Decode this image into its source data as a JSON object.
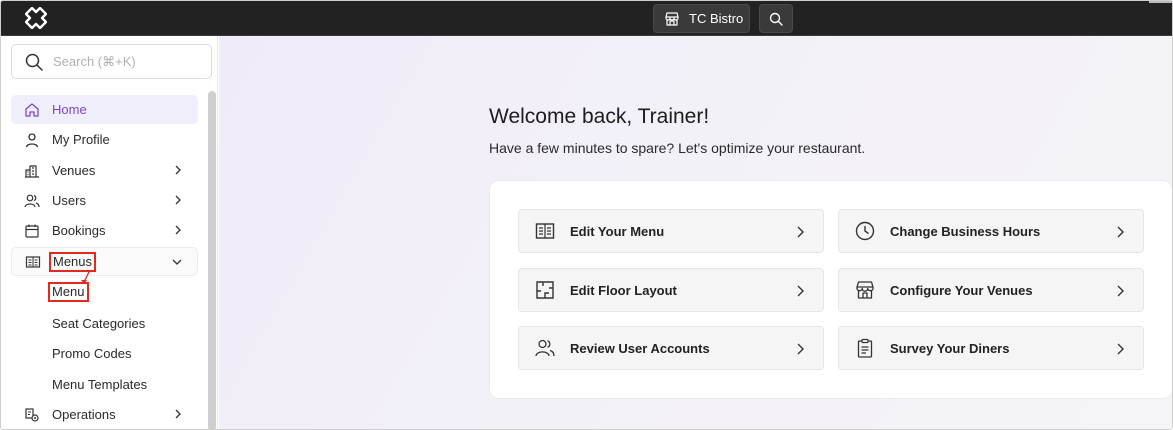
{
  "app": {
    "venue_name": "TC Bistro"
  },
  "sidebar": {
    "search_placeholder": "Search (⌘+K)",
    "items": [
      {
        "label": "Home",
        "icon": "home-icon"
      },
      {
        "label": "My Profile",
        "icon": "person-icon"
      },
      {
        "label": "Venues",
        "icon": "buildings-icon"
      },
      {
        "label": "Users",
        "icon": "users-icon"
      },
      {
        "label": "Bookings",
        "icon": "calendar-icon"
      },
      {
        "label": "Menus",
        "icon": "menu-book-icon"
      },
      {
        "label": "Operations",
        "icon": "operations-icon"
      }
    ],
    "sub_items": [
      {
        "label": "Menu"
      },
      {
        "label": "Seat Categories"
      },
      {
        "label": "Promo Codes"
      },
      {
        "label": "Menu Templates"
      }
    ]
  },
  "main": {
    "welcome": "Welcome back, Trainer!",
    "subtitle": "Have a few minutes to spare? Let's optimize your restaurant.",
    "tiles": [
      {
        "label": "Edit Your Menu",
        "icon": "menu-book-icon"
      },
      {
        "label": "Change Business Hours",
        "icon": "clock-icon"
      },
      {
        "label": "Edit Floor Layout",
        "icon": "floor-plan-icon"
      },
      {
        "label": "Configure Your Venues",
        "icon": "storefront-icon"
      },
      {
        "label": "Review User Accounts",
        "icon": "users-icon"
      },
      {
        "label": "Survey Your Diners",
        "icon": "clipboard-icon"
      }
    ]
  },
  "colors": {
    "accent": "#7a46c9",
    "highlight": "#e02a1e",
    "topbar": "#222222"
  }
}
